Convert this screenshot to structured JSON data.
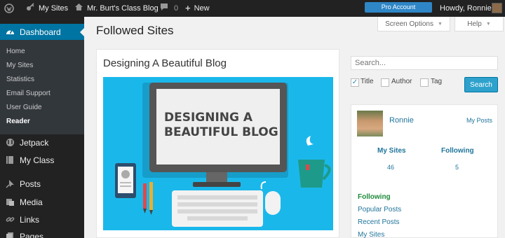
{
  "adminbar": {
    "my_sites": "My Sites",
    "blog_name": "Mr. Burt's Class Blog",
    "comments_count": "0",
    "new_label": "New",
    "pro_account": "Pro Account",
    "howdy": "Howdy, Ronnie"
  },
  "sidebar": {
    "dashboard": "Dashboard",
    "submenu": [
      "Home",
      "My Sites",
      "Statistics",
      "Email Support",
      "User Guide",
      "Reader"
    ],
    "menu": [
      "Jetpack",
      "My Class",
      "Posts",
      "Media",
      "Links",
      "Pages"
    ]
  },
  "page": {
    "title": "Followed Sites",
    "screen_options": "Screen Options",
    "help": "Help"
  },
  "post": {
    "title": "Designing A Beautiful Blog",
    "image_line1": "DESIGNING A",
    "image_line2": "BEAUTIFUL BLOG"
  },
  "search": {
    "placeholder": "Search...",
    "filters": [
      "Title",
      "Author",
      "Tag"
    ],
    "button": "Search"
  },
  "profile": {
    "name": "Ronnie",
    "my_posts": "My Posts",
    "stats": [
      {
        "label": "My Sites",
        "value": "46"
      },
      {
        "label": "Following",
        "value": "5"
      }
    ],
    "links": [
      "Following",
      "Popular Posts",
      "Recent Posts",
      "My Sites"
    ]
  },
  "colors": {
    "adminbar": "#222222",
    "sidebar_active": "#0074a2",
    "accent_button": "#2ea2cc",
    "link": "#21759b",
    "current_link": "#1e8a3c",
    "image_bg": "#1ab8ea"
  }
}
